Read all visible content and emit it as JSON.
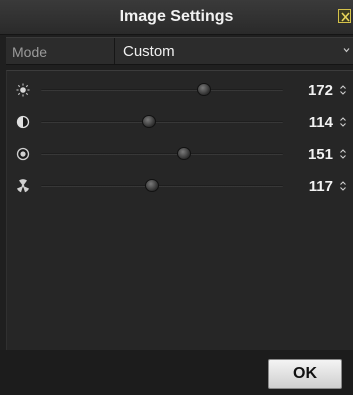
{
  "dialog": {
    "title": "Image Settings"
  },
  "mode": {
    "label": "Mode",
    "value": "Custom"
  },
  "sliders": [
    {
      "name": "brightness",
      "icon": "brightness-icon",
      "value": "172",
      "max": 255
    },
    {
      "name": "contrast",
      "icon": "contrast-icon",
      "value": "114",
      "max": 255
    },
    {
      "name": "saturation",
      "icon": "saturation-icon",
      "value": "151",
      "max": 255
    },
    {
      "name": "sharpness",
      "icon": "sharpness-icon",
      "value": "117",
      "max": 255
    }
  ],
  "footer": {
    "ok_label": "OK"
  },
  "colors": {
    "background": "#1f1f1f",
    "title_text": "#f2f2f2",
    "close_accent": "#d5c24a"
  }
}
